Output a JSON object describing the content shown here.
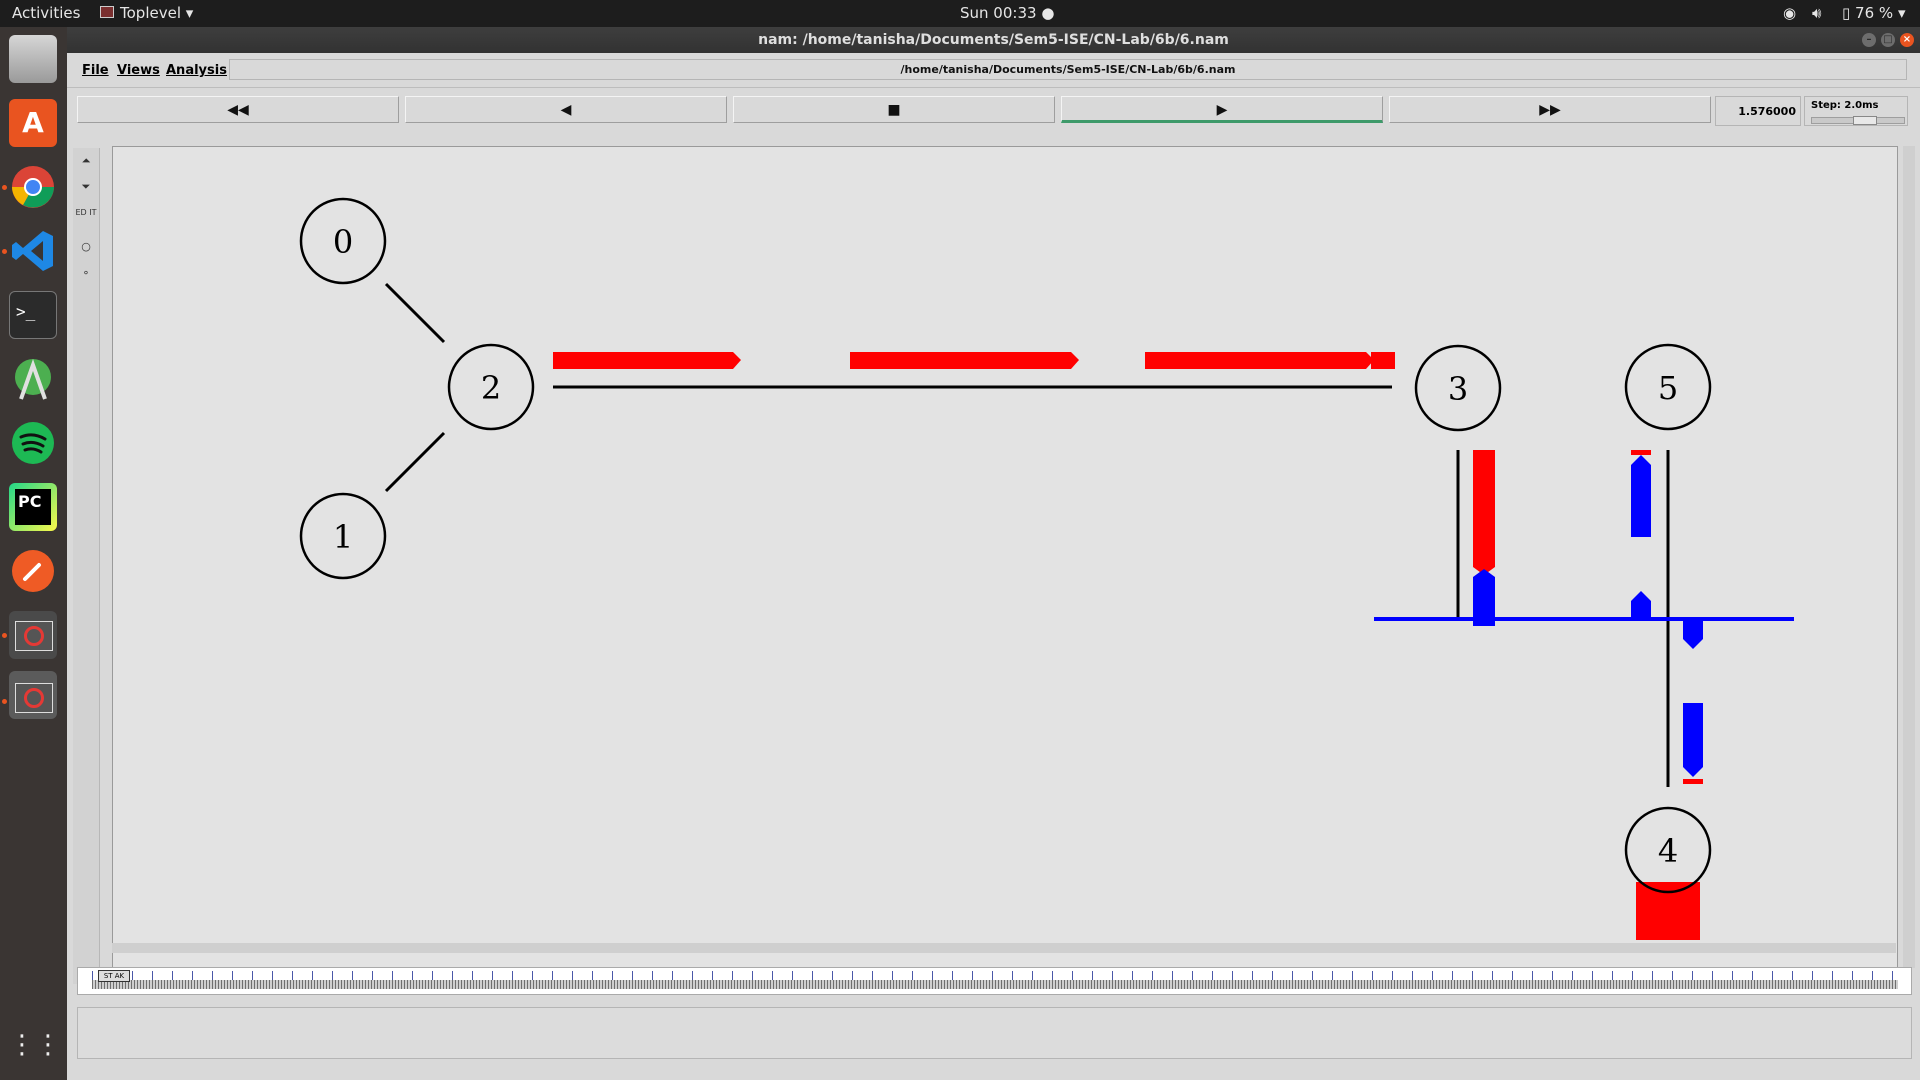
{
  "topbar": {
    "activities": "Activities",
    "app_menu": "Toplevel",
    "clock": "Sun 00:33",
    "battery": "76 %"
  },
  "window": {
    "title": "nam: /home/tanisha/Documents/Sem5-ISE/CN-Lab/6b/6.nam",
    "menu": {
      "file": "File",
      "views": "Views",
      "analysis": "Analysis"
    },
    "path": "/home/tanisha/Documents/Sem5-ISE/CN-Lab/6b/6.nam"
  },
  "controls": {
    "rewind": "◀◀",
    "back": "◀",
    "stop": "■",
    "play": "▶",
    "fast_forward": "▶▶",
    "time": "1.576000",
    "step": "Step: 2.0ms"
  },
  "tools": {
    "edit": "ED IT"
  },
  "nodes": {
    "n0": "0",
    "n1": "1",
    "n2": "2",
    "n3": "3",
    "n4": "4",
    "n5": "5"
  },
  "timeline": {
    "marker": "ST AK"
  },
  "colors": {
    "packet_red": "#ff0000",
    "packet_blue": "#0000ff",
    "lan": "#0000ff",
    "active_underline": "#3e9a6a"
  },
  "icons": {
    "dock": [
      "files-icon",
      "software-center-icon",
      "chrome-icon",
      "vscode-icon",
      "terminal-icon",
      "android-studio-icon",
      "spotify-icon",
      "pycharm-icon",
      "postman-icon",
      "nam-window-icon",
      "nam-window-icon",
      "show-apps-icon"
    ],
    "tray": [
      "wifi-icon",
      "volume-icon",
      "battery-icon"
    ]
  }
}
